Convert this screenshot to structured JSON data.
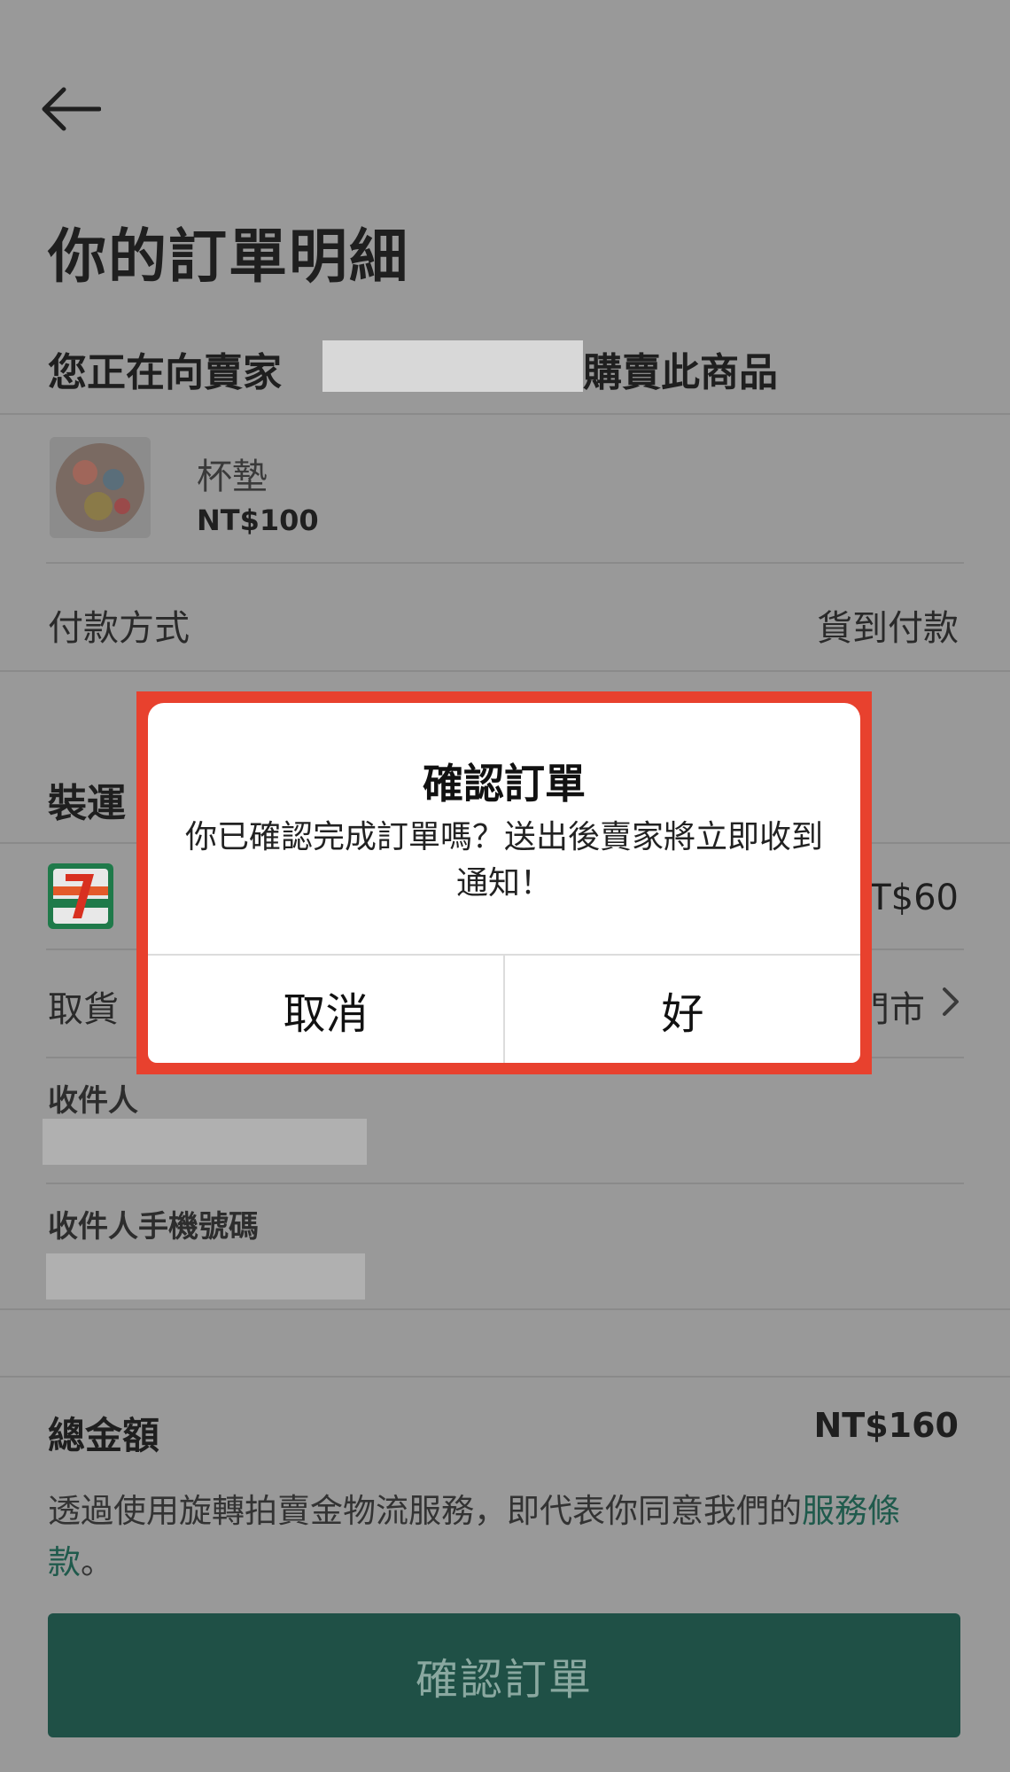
{
  "header": {
    "back_icon": "arrow-left-icon"
  },
  "page_title": "你的訂單明細",
  "seller": {
    "prefix": "您正在向賣家",
    "suffix": "購賣此商品"
  },
  "product": {
    "name": "杯墊",
    "price": "NT$100"
  },
  "payment": {
    "label": "付款方式",
    "value": "貨到付款"
  },
  "shipping": {
    "label": "裝運",
    "logo": "7-eleven-logo",
    "price": "NT$60",
    "pickup_label": "取貨",
    "pickup_value": "門市",
    "chevron_icon": "chevron-right-icon"
  },
  "recipient": {
    "name_label": "收件人",
    "phone_label": "收件人手機號碼"
  },
  "total": {
    "label": "總金額",
    "value": "NT$160"
  },
  "terms": {
    "text": "透過使用旋轉拍賣金物流服務，即代表你同意我們的",
    "link": "服務條款",
    "end": "。"
  },
  "confirm_button": {
    "label": "確認訂單"
  },
  "dialog": {
    "title": "確認訂單",
    "message": "你已確認完成訂單嗎？送出後賣家將立即收到通知！",
    "cancel_label": "取消",
    "ok_label": "好"
  },
  "colors": {
    "highlight": "#e8412e",
    "primary_button": "#1f5046",
    "link": "#1f5a4c"
  }
}
